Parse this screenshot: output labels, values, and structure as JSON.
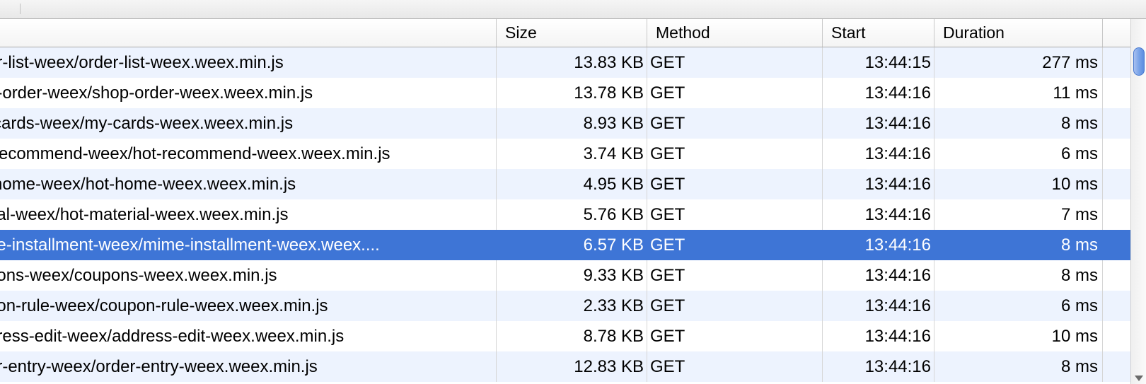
{
  "headers": {
    "name": "",
    "size": "Size",
    "method": "Method",
    "start": "Start",
    "duration": "Duration"
  },
  "rows": [
    {
      "name": "er-list-weex/order-list-weex.weex.min.js",
      "size": "13.83 KB",
      "method": "GET",
      "start": "13:44:15",
      "duration": "277 ms",
      "selected": false
    },
    {
      "name": "p-order-weex/shop-order-weex.weex.min.js",
      "size": "13.78 KB",
      "method": "GET",
      "start": "13:44:16",
      "duration": "11 ms",
      "selected": false
    },
    {
      "name": "-cards-weex/my-cards-weex.weex.min.js",
      "size": "8.93 KB",
      "method": "GET",
      "start": "13:44:16",
      "duration": "8 ms",
      "selected": false
    },
    {
      "name": "-recommend-weex/hot-recommend-weex.weex.min.js",
      "size": "3.74 KB",
      "method": "GET",
      "start": "13:44:16",
      "duration": "6 ms",
      "selected": false
    },
    {
      "name": "-home-weex/hot-home-weex.weex.min.js",
      "size": "4.95 KB",
      "method": "GET",
      "start": "13:44:16",
      "duration": "10 ms",
      "selected": false
    },
    {
      "name": "rial-weex/hot-material-weex.weex.min.js",
      "size": "5.76 KB",
      "method": "GET",
      "start": "13:44:16",
      "duration": "7 ms",
      "selected": false
    },
    {
      "name": "ne-installment-weex/mime-installment-weex.weex....",
      "size": "6.57 KB",
      "method": "GET",
      "start": "13:44:16",
      "duration": "8 ms",
      "selected": true
    },
    {
      "name": "pons-weex/coupons-weex.weex.min.js",
      "size": "9.33 KB",
      "method": "GET",
      "start": "13:44:16",
      "duration": "8 ms",
      "selected": false
    },
    {
      "name": "pon-rule-weex/coupon-rule-weex.weex.min.js",
      "size": "2.33 KB",
      "method": "GET",
      "start": "13:44:16",
      "duration": "6 ms",
      "selected": false
    },
    {
      "name": "dress-edit-weex/address-edit-weex.weex.min.js",
      "size": "8.78 KB",
      "method": "GET",
      "start": "13:44:16",
      "duration": "10 ms",
      "selected": false
    },
    {
      "name": "er-entry-weex/order-entry-weex.weex.min.js",
      "size": "12.83 KB",
      "method": "GET",
      "start": "13:44:16",
      "duration": "8 ms",
      "selected": false
    }
  ]
}
